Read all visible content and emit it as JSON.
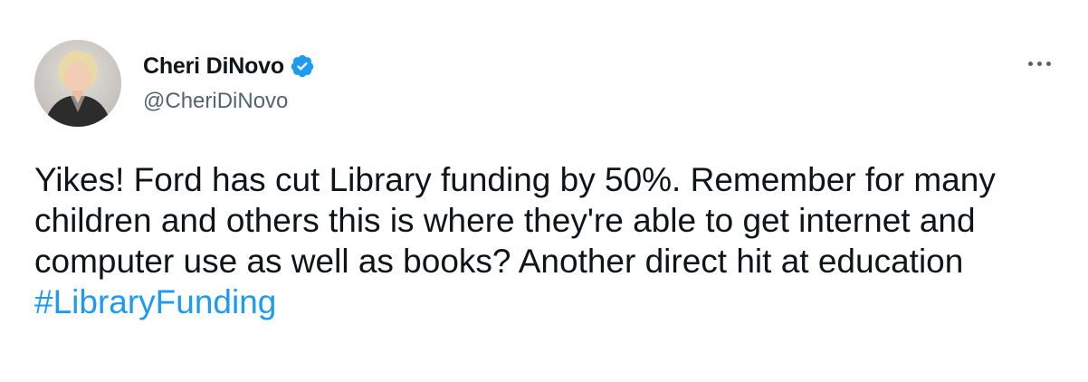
{
  "author": {
    "display_name": "Cheri DiNovo",
    "handle": "@CheriDiNovo",
    "verified": true,
    "avatar_icon": "profile-photo"
  },
  "tweet": {
    "text": "Yikes! Ford has cut Library funding by 50%. Remember for many children and others this is where they're able to get internet and computer use as well as books? Another direct hit at education",
    "hashtag": "#LibraryFunding"
  },
  "icons": {
    "verified": "verified-badge-icon",
    "more": "more-options-icon"
  },
  "colors": {
    "verified_badge": "#1d9bf0",
    "hashtag": "#1d9bf0",
    "text_primary": "#0f1419",
    "text_secondary": "#536471"
  }
}
